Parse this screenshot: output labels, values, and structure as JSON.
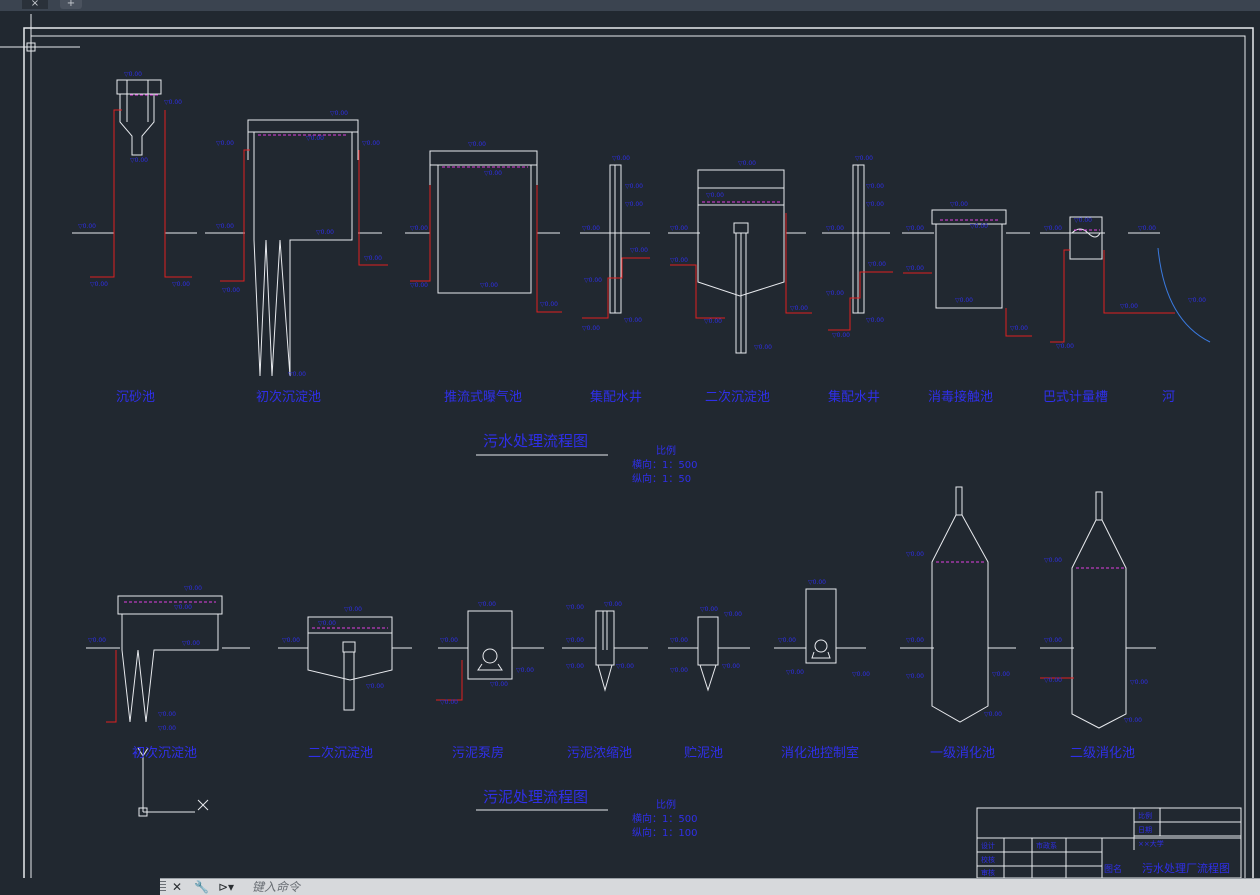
{
  "tabs": {
    "close_glyph": "×",
    "add_glyph": "+"
  },
  "command_bar": {
    "close_glyph": "✕",
    "settings_glyph": "🔧",
    "prompt_glyph": "⊳▾",
    "placeholder": "键入命令"
  },
  "drawing": {
    "process1": {
      "title": "污水处理流程图",
      "scale_title": "比例",
      "scale_h": "横向：1：500",
      "scale_v": "纵向：1：50",
      "labels": [
        "沉砂池",
        "初次沉淀池",
        "推流式曝气池",
        "集配水井",
        "二次沉淀池",
        "集配水井",
        "消毒接触池",
        "巴式计量槽",
        "河"
      ]
    },
    "process2": {
      "title": "污泥处理流程图",
      "scale_title": "比例",
      "scale_h": "横向：1：500",
      "scale_v": "纵向：1：100",
      "labels": [
        "初次沉淀池",
        "二次沉淀池",
        "污泥泵房",
        "污泥浓缩池",
        "贮泥池",
        "消化池控制室",
        "一级消化池",
        "二级消化池"
      ]
    },
    "title_block": {
      "drawing_name": "污水处理厂流程图",
      "design": "设计",
      "check": "校核",
      "approve": "审核",
      "scale_label": "比例",
      "date_label": "日期",
      "school": "××大学",
      "dept": "市政系",
      "drawing_label": "图名"
    }
  },
  "colors": {
    "background": "#212830",
    "line": "#e8eaee",
    "accent_red": "#e02020",
    "label_blue": "#2f2fe8",
    "water_magenta": "#e040e0"
  }
}
